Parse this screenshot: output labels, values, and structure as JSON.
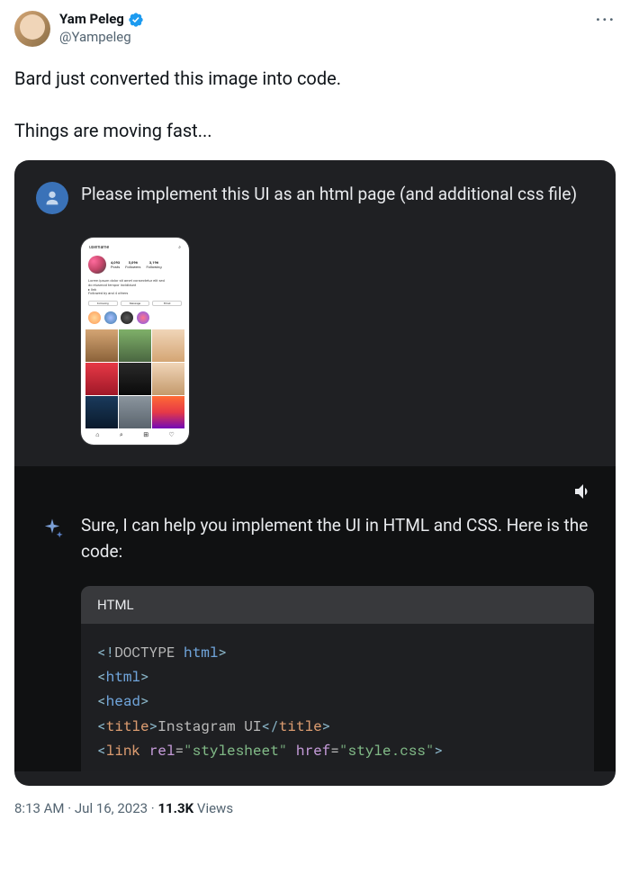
{
  "author": {
    "display_name": "Yam Peleg",
    "handle": "@Yampeleg"
  },
  "tweet": {
    "line1": "Bard just converted this image into code.",
    "line2": "Things are moving fast..."
  },
  "chat": {
    "user_prompt": "Please implement this UI as an html page (and additional css file)",
    "ai_response": "Sure, I can help you implement the UI in HTML and CSS. Here is the code:",
    "code_label": "HTML",
    "code": {
      "doctype": "<!DOCTYPE",
      "doctype_val": "html",
      "doctype_close": ">",
      "html_open": "<html>",
      "head_open": "<head>",
      "title_open": "<title>",
      "title_text": "Instagram UI",
      "title_close": "</title>",
      "link_open": "<link",
      "link_attr1": "rel",
      "link_val1": "\"stylesheet\"",
      "link_attr2": "href",
      "link_val2": "\"style.css\"",
      "link_close": ">"
    }
  },
  "phone": {
    "username": "username",
    "stats": [
      {
        "num": "4,093",
        "label": "Posts"
      },
      {
        "num": "5,096",
        "label": "Followers"
      },
      {
        "num": "3,196",
        "label": "Following"
      }
    ],
    "buttons": [
      "Following",
      "Message",
      "Email"
    ]
  },
  "meta": {
    "time": "8:13 AM",
    "date": "Jul 16, 2023",
    "views_count": "11.3K",
    "views_label": "Views"
  }
}
